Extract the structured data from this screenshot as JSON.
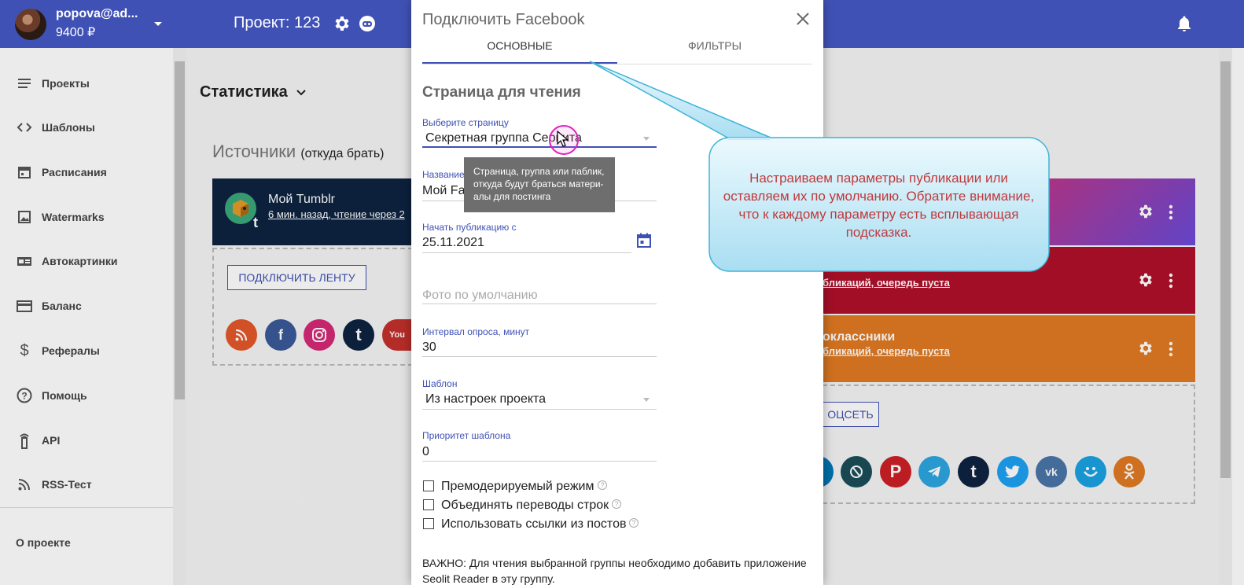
{
  "header": {
    "user_email": "popova@ad...",
    "balance": "9400 ₽",
    "project_title": "Проект: 123"
  },
  "sidebar": {
    "items": [
      {
        "label": "Проекты",
        "icon": "list-icon"
      },
      {
        "label": "Шаблоны",
        "icon": "code-icon"
      },
      {
        "label": "Расписания",
        "icon": "calendar-icon"
      },
      {
        "label": "Watermarks",
        "icon": "image-icon"
      },
      {
        "label": "Автокартинки",
        "icon": "autoimage-icon"
      },
      {
        "label": "Баланс",
        "icon": "card-icon"
      },
      {
        "label": "Рефералы",
        "icon": "dollar-icon"
      },
      {
        "label": "Помощь",
        "icon": "help-icon"
      },
      {
        "label": "API",
        "icon": "api-icon"
      },
      {
        "label": "RSS-Тест",
        "icon": "rss-icon"
      }
    ],
    "about": "О проекте"
  },
  "main": {
    "stats_title": "Статистика",
    "sources_title": "Источники",
    "sources_subtitle": "(откуда брать)",
    "tumblr": {
      "name": "Мой Tumblr",
      "meta": "6 мин. назад, чтение через 2"
    },
    "connect_feed": "ПОДКЛЮЧИТЬ ЛЕНТУ",
    "right_cards": [
      {
        "title": "",
        "meta": ""
      },
      {
        "title": "",
        "meta": "бликаций, очередь пуста"
      },
      {
        "title": "оклассники",
        "meta": "бликаций, очередь пуста"
      }
    ],
    "connect_social": "ОЦСЕТЬ"
  },
  "modal": {
    "title": "Подключить Facebook",
    "tabs": [
      "ОСНОВНЫЕ",
      "ФИЛЬТРЫ"
    ],
    "section_title": "Страница для чтения",
    "page_label": "Выберите страницу",
    "page_value": "Секретная группа Сервита",
    "name_label": "Название",
    "name_value": "Мой Fac",
    "start_label": "Начать публикацию с",
    "start_value": "25.11.2021",
    "photo_placeholder": "Фото по умолчанию",
    "interval_label": "Интервал опроса, минут",
    "interval_value": "30",
    "template_label": "Шаблон",
    "template_value": "Из настроек проекта",
    "priority_label": "Приоритет шаблона",
    "priority_value": "0",
    "checkboxes": [
      "Премодерируемый режим",
      "Объединять переводы строк",
      "Использовать ссылки из постов"
    ],
    "important": "ВАЖНО: Для чтения выбранной группы необходимо добавить приложение Seolit Reader в эту группу."
  },
  "tooltip": {
    "text": "Страница, группа или паблик, откуда будут браться матери-алы для постинга"
  },
  "callout": {
    "text": "Настраиваем параметры публикации или оставляем их по умолчанию. Обратите внимание, что к каждому параметру есть всплывающая подсказка."
  }
}
